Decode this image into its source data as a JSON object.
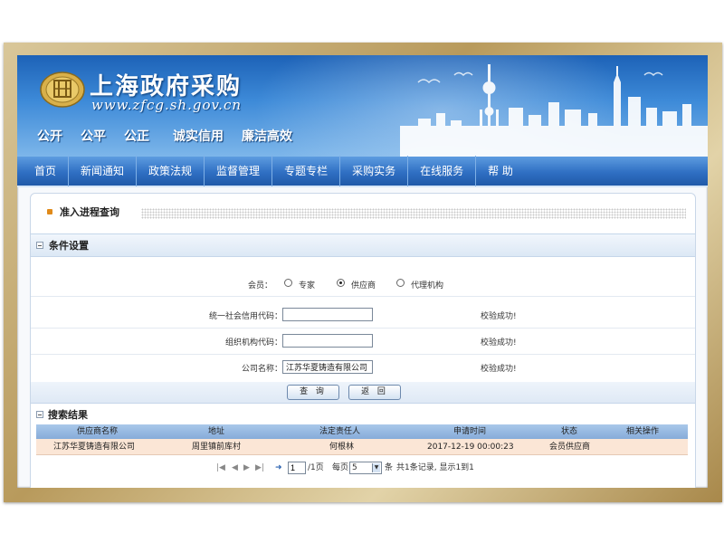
{
  "header": {
    "site_title": "上海政府采购",
    "site_url": "www.zfcg.sh.gov.cn",
    "slogans": [
      "公开",
      "公平",
      "公正",
      "诚实信用",
      "廉洁高效"
    ]
  },
  "nav": {
    "items": [
      "首页",
      "新闻通知",
      "政策法规",
      "监督管理",
      "专题专栏",
      "采购实务",
      "在线服务",
      "帮 助"
    ]
  },
  "page": {
    "title": "准入进程查询"
  },
  "conditions": {
    "section_label": "条件设置",
    "member_label": "会员：",
    "member_options": [
      "专家",
      "供应商",
      "代理机构"
    ],
    "member_selected": "供应商",
    "credit_code_label": "统一社会信用代码：",
    "credit_code_value": "",
    "credit_code_status": "校验成功!",
    "org_code_label": "组织机构代码：",
    "org_code_value": "",
    "org_code_status": "校验成功!",
    "company_label": "公司名称：",
    "company_value": "江苏华夏铸造有限公司",
    "company_status": "校验成功!",
    "search_button": "查 询",
    "back_button": "返 回"
  },
  "results": {
    "section_label": "搜索结果",
    "columns": [
      "供应商名称",
      "地址",
      "法定责任人",
      "申请时间",
      "状态",
      "相关操作"
    ],
    "rows": [
      [
        "江苏华夏铸造有限公司",
        "周里镇前库村",
        "何根林",
        "2017-12-19 00:00:23",
        "会员供应商",
        ""
      ]
    ]
  },
  "pager": {
    "page_value": "1",
    "page_total": "/1页",
    "per_page_label": "每页",
    "per_page_value": "5",
    "per_page_unit": "条",
    "summary": "共1条记录, 显示1到1"
  },
  "colors": {
    "banner_top": "#1d62b7",
    "nav": "#2f6fc3",
    "table_header": "#86abd9",
    "row_highlight": "#fbe6d6",
    "frame_gold": "#b89a5c"
  }
}
